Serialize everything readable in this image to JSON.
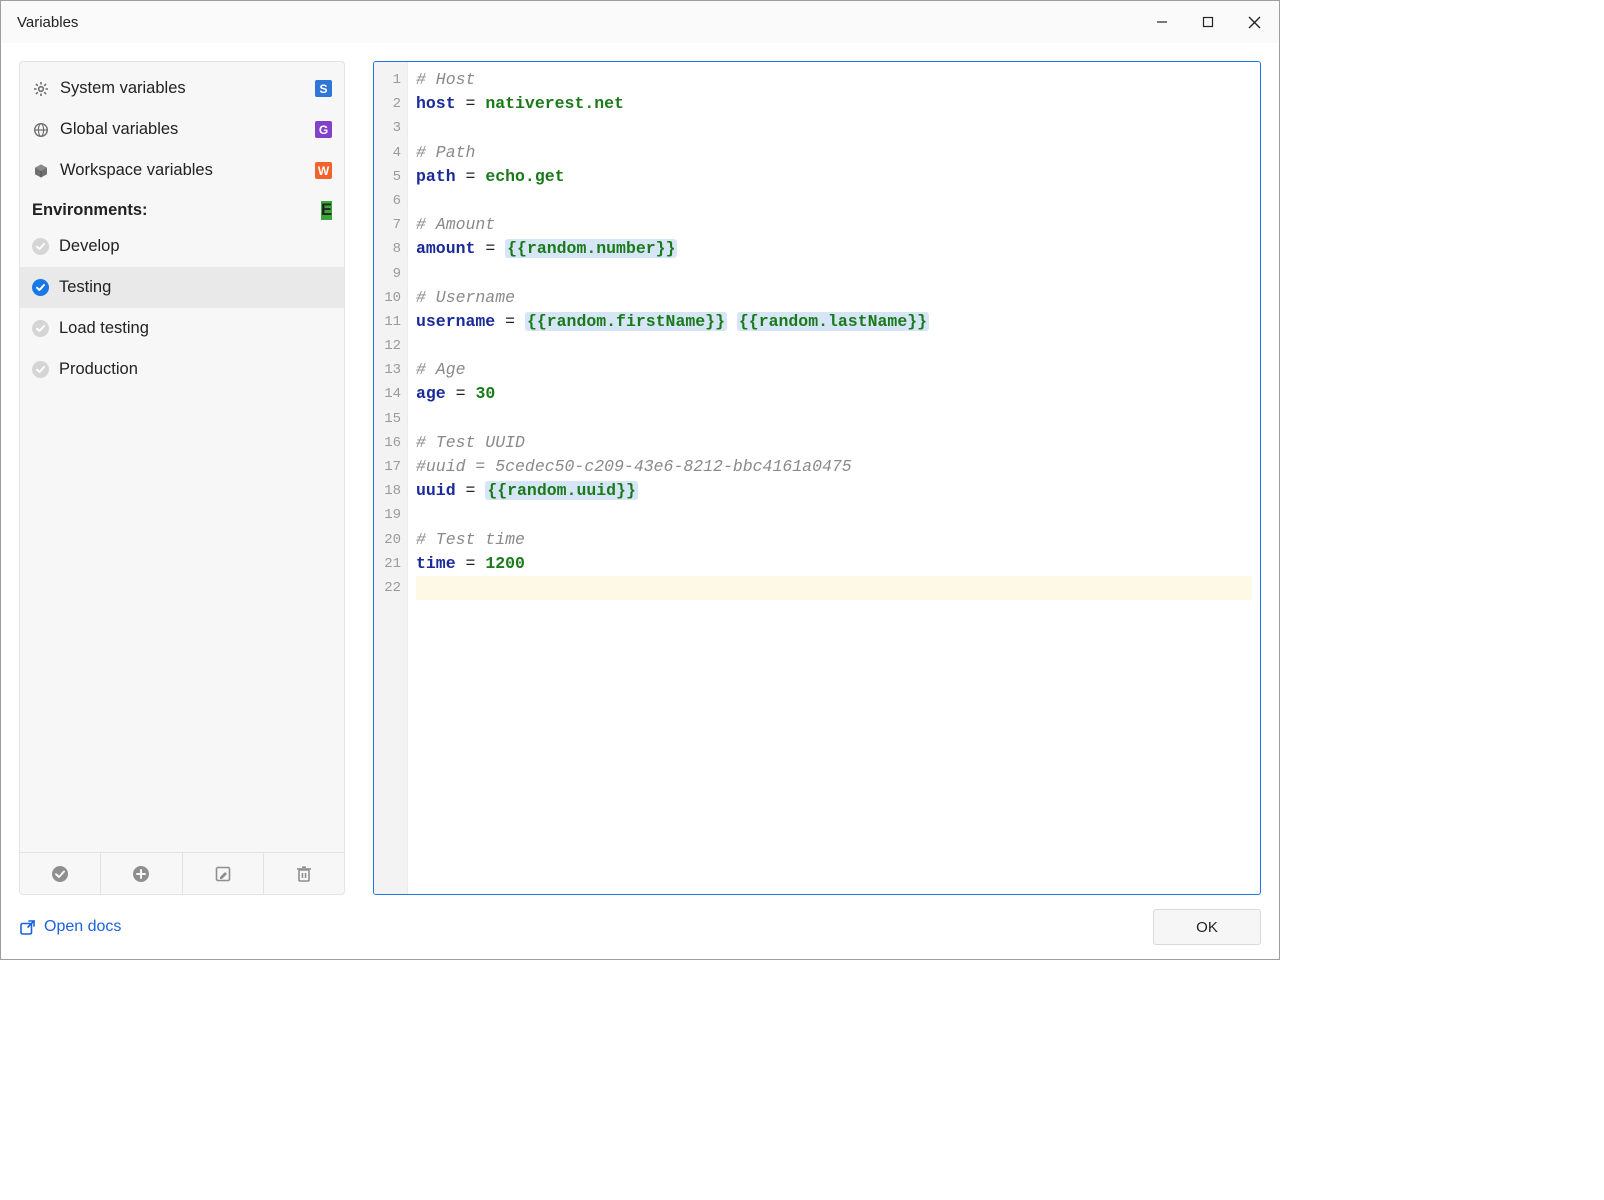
{
  "window": {
    "title": "Variables",
    "ok_label": "OK",
    "open_docs_label": "Open docs"
  },
  "sidebar": {
    "fixed": [
      {
        "label": "System variables",
        "badge": "S",
        "badge_class": "badge-s",
        "icon": "gear"
      },
      {
        "label": "Global variables",
        "badge": "G",
        "badge_class": "badge-g",
        "icon": "globe"
      },
      {
        "label": "Workspace variables",
        "badge": "W",
        "badge_class": "badge-w",
        "icon": "cube"
      }
    ],
    "env_header": "Environments:",
    "env_badge": "E",
    "environments": [
      {
        "label": "Develop",
        "active": false
      },
      {
        "label": "Testing",
        "active": true,
        "selected": true
      },
      {
        "label": "Load testing",
        "active": false
      },
      {
        "label": "Production",
        "active": false
      }
    ]
  },
  "editor": {
    "lines": [
      {
        "n": 1,
        "tokens": [
          {
            "t": "# Host",
            "c": "comment"
          }
        ]
      },
      {
        "n": 2,
        "tokens": [
          {
            "t": "host",
            "c": "key"
          },
          {
            "t": " = ",
            "c": "eq"
          },
          {
            "t": "nativerest.net",
            "c": "val"
          }
        ]
      },
      {
        "n": 3,
        "tokens": []
      },
      {
        "n": 4,
        "tokens": [
          {
            "t": "# Path",
            "c": "comment"
          }
        ]
      },
      {
        "n": 5,
        "tokens": [
          {
            "t": "path",
            "c": "key"
          },
          {
            "t": " = ",
            "c": "eq"
          },
          {
            "t": "echo.get",
            "c": "val"
          }
        ]
      },
      {
        "n": 6,
        "tokens": []
      },
      {
        "n": 7,
        "tokens": [
          {
            "t": "# Amount",
            "c": "comment"
          }
        ]
      },
      {
        "n": 8,
        "tokens": [
          {
            "t": "amount",
            "c": "key"
          },
          {
            "t": " = ",
            "c": "eq"
          },
          {
            "t": "{{random.number}}",
            "c": "tmpl"
          }
        ]
      },
      {
        "n": 9,
        "tokens": []
      },
      {
        "n": 10,
        "tokens": [
          {
            "t": "# Username",
            "c": "comment"
          }
        ]
      },
      {
        "n": 11,
        "tokens": [
          {
            "t": "username",
            "c": "key"
          },
          {
            "t": " = ",
            "c": "eq"
          },
          {
            "t": "{{random.firstName}}",
            "c": "tmpl"
          },
          {
            "t": " ",
            "c": "eq"
          },
          {
            "t": "{{random.lastName}}",
            "c": "tmpl"
          }
        ]
      },
      {
        "n": 12,
        "tokens": []
      },
      {
        "n": 13,
        "tokens": [
          {
            "t": "# Age",
            "c": "comment"
          }
        ]
      },
      {
        "n": 14,
        "tokens": [
          {
            "t": "age",
            "c": "key"
          },
          {
            "t": " = ",
            "c": "eq"
          },
          {
            "t": "30",
            "c": "val"
          }
        ]
      },
      {
        "n": 15,
        "tokens": []
      },
      {
        "n": 16,
        "tokens": [
          {
            "t": "# Test UUID",
            "c": "comment"
          }
        ]
      },
      {
        "n": 17,
        "tokens": [
          {
            "t": "#uuid = 5cedec50-c209-43e6-8212-bbc4161a0475",
            "c": "comment"
          }
        ]
      },
      {
        "n": 18,
        "tokens": [
          {
            "t": "uuid",
            "c": "key"
          },
          {
            "t": " = ",
            "c": "eq"
          },
          {
            "t": "{{random.uuid}}",
            "c": "tmpl"
          }
        ]
      },
      {
        "n": 19,
        "tokens": []
      },
      {
        "n": 20,
        "tokens": [
          {
            "t": "# Test time",
            "c": "comment"
          }
        ]
      },
      {
        "n": 21,
        "tokens": [
          {
            "t": "time",
            "c": "key"
          },
          {
            "t": " = ",
            "c": "eq"
          },
          {
            "t": "1200",
            "c": "val"
          }
        ]
      },
      {
        "n": 22,
        "tokens": [],
        "cursor": true
      }
    ]
  }
}
